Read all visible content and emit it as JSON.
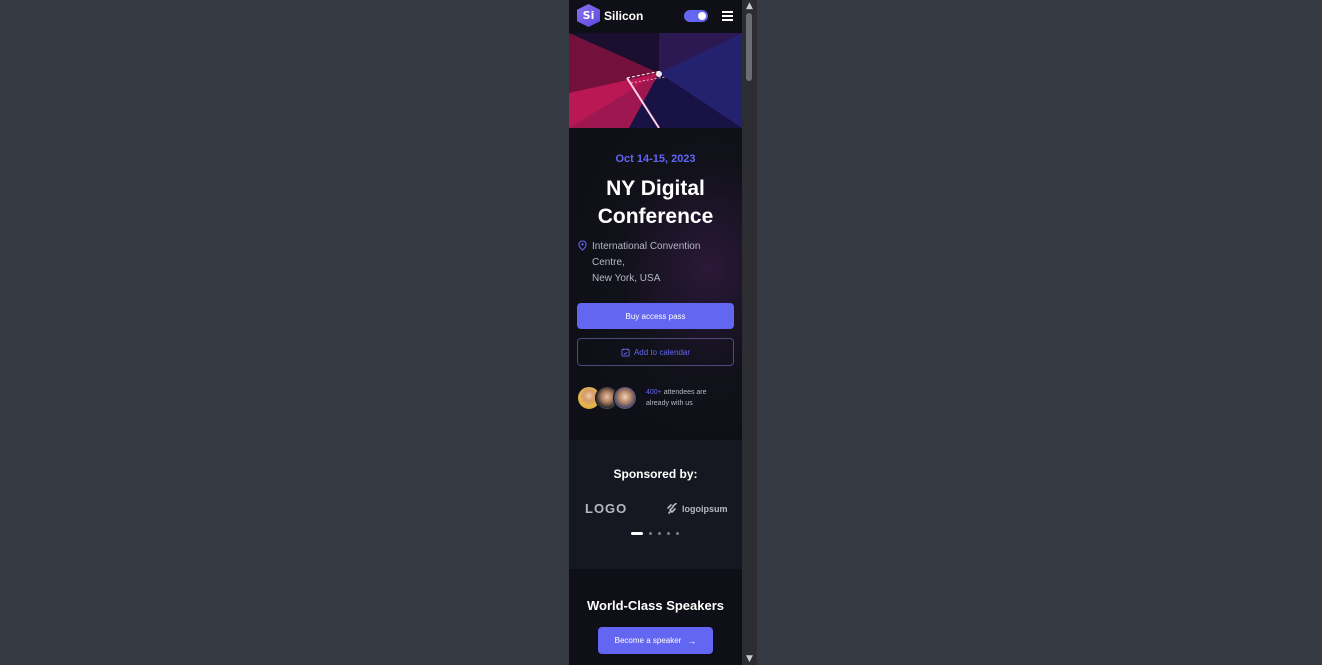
{
  "navbar": {
    "logo_mark": "Si",
    "brand": "Silicon",
    "theme_toggle_state": "on"
  },
  "hero": {
    "date": "Oct 14-15, 2023",
    "title_line1": "NY Digital",
    "title_line2": "Conference",
    "location_line1": "International Convention",
    "location_line2": "Centre,",
    "location_line3": "New York, USA",
    "buy_button": "Buy access pass",
    "calendar_button": "Add to calendar",
    "attendees_count": "400+",
    "attendees_text_1": " attendees are",
    "attendees_text_2": "already with us"
  },
  "sponsors": {
    "title": "Sponsored by:",
    "logo1": "LOGO",
    "logo2": "logoipsum",
    "active_slide": 1,
    "slide_count": 5
  },
  "speakers": {
    "title": "World-Class Speakers",
    "button": "Become a speaker"
  },
  "colors": {
    "accent": "#6366f1",
    "page_bg": "#353942",
    "surface": "#0f1017",
    "surface_alt": "#161821"
  }
}
